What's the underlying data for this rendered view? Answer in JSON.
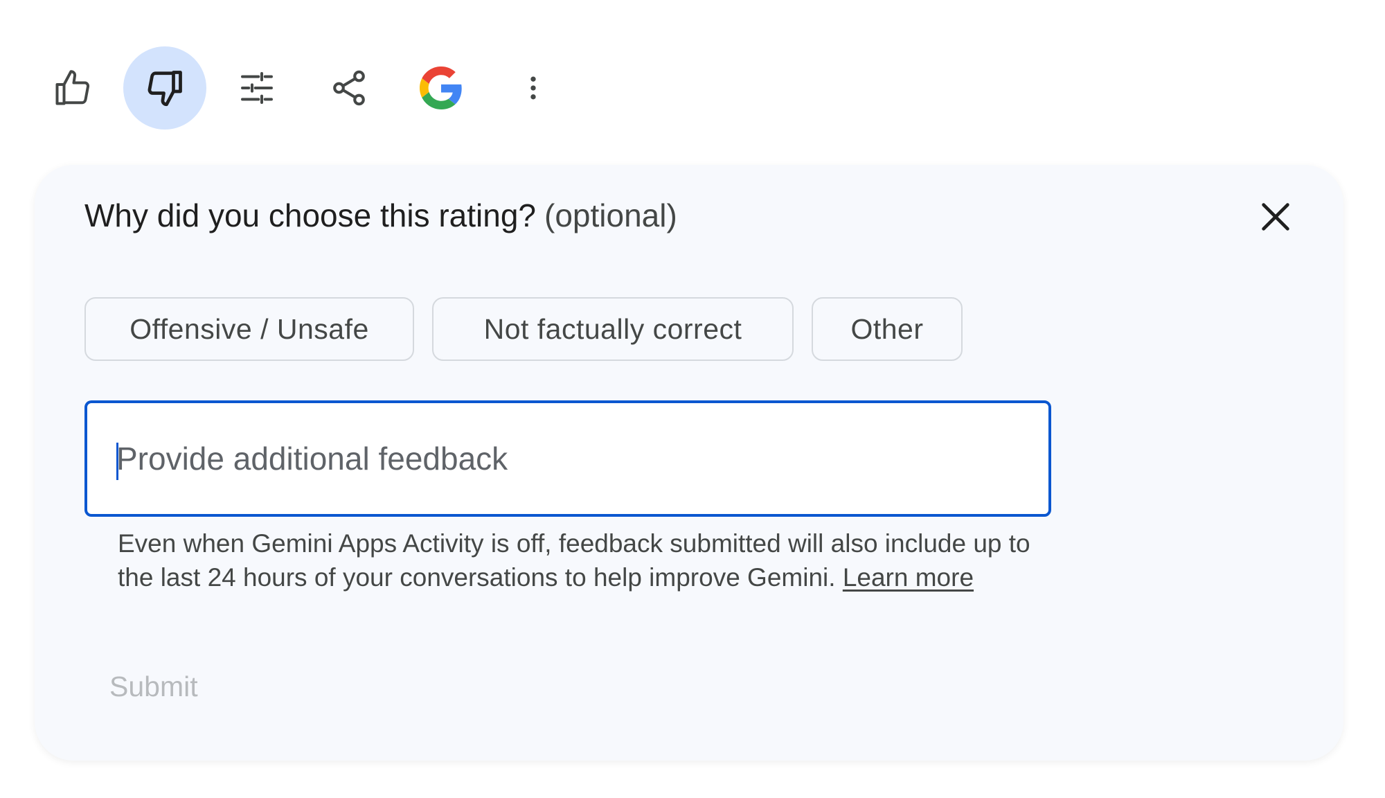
{
  "toolbar": {
    "buttons": [
      {
        "icon": "thumb-up-icon",
        "active": false
      },
      {
        "icon": "thumb-down-icon",
        "active": true
      },
      {
        "icon": "tune-icon",
        "active": false
      },
      {
        "icon": "share-icon",
        "active": false
      },
      {
        "icon": "google-icon",
        "active": false
      },
      {
        "icon": "more-vert-icon",
        "active": false
      }
    ],
    "active_bg_color": "#d3e3fd"
  },
  "feedback": {
    "title": "Why did you choose this rating?",
    "optional_label": "(optional)",
    "close_icon": "close-icon",
    "chips": [
      {
        "label": "Offensive / Unsafe"
      },
      {
        "label": "Not factually correct"
      },
      {
        "label": "Other"
      }
    ],
    "input": {
      "placeholder": "Provide additional feedback",
      "value": ""
    },
    "disclaimer_text": "Even when Gemini Apps Activity is off, feedback submitted will also include up to the last 24 hours of your conversations to help improve Gemini.",
    "learn_more_label": "Learn more",
    "submit_label": "Submit",
    "submit_enabled": false
  },
  "colors": {
    "accent": "#0b57d0",
    "card_bg": "#f7f9fd",
    "text": "#1f1f1f",
    "muted_text": "#444746",
    "disabled_text": "#b7babd"
  }
}
